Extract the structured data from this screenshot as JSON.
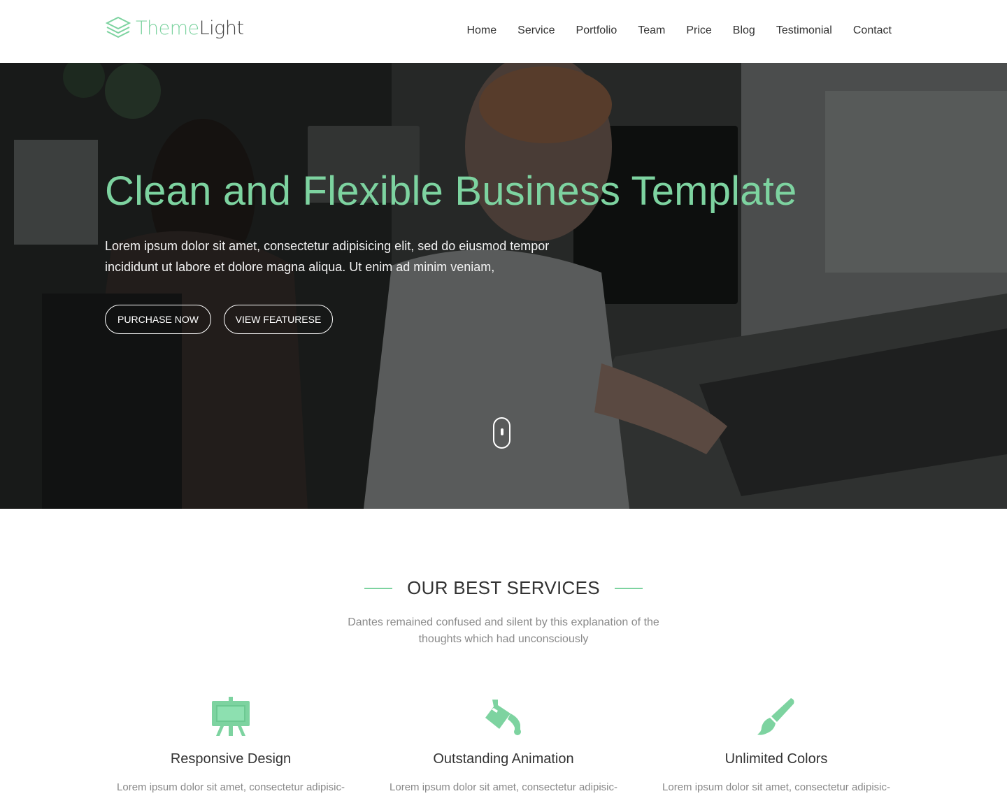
{
  "header": {
    "logo": {
      "part1": "Theme",
      "part2": "Light"
    },
    "nav": [
      "Home",
      "Service",
      "Portfolio",
      "Team",
      "Price",
      "Blog",
      "Testimonial",
      "Contact"
    ]
  },
  "hero": {
    "title": "Clean and Flexible Business Template",
    "text": "Lorem ipsum dolor sit amet, consectetur adipisicing elit, sed do eiusmod tempor incididunt ut labore et dolore magna aliqua. Ut enim ad minim veniam,",
    "buttons": {
      "purchase": "PURCHASE NOW",
      "features": "VIEW FEATURESE"
    }
  },
  "services": {
    "title": "OUR BEST SERVICES",
    "subtitle": "Dantes remained confused and silent by this explanation of the thoughts which had unconsciously",
    "items": [
      {
        "icon": "easel-icon",
        "title": "Responsive Design",
        "text": "Lorem ipsum dolor sit amet, consectetur adipisic-"
      },
      {
        "icon": "paint-bucket-icon",
        "title": "Outstanding Animation",
        "text": "Lorem ipsum dolor sit amet, consectetur adipisic-"
      },
      {
        "icon": "paintbrush-icon",
        "title": "Unlimited Colors",
        "text": "Lorem ipsum dolor sit amet, consectetur adipisic-"
      }
    ]
  },
  "colors": {
    "accent": "#7dd3a0",
    "text": "#333333",
    "muted": "#8a8a8a"
  }
}
